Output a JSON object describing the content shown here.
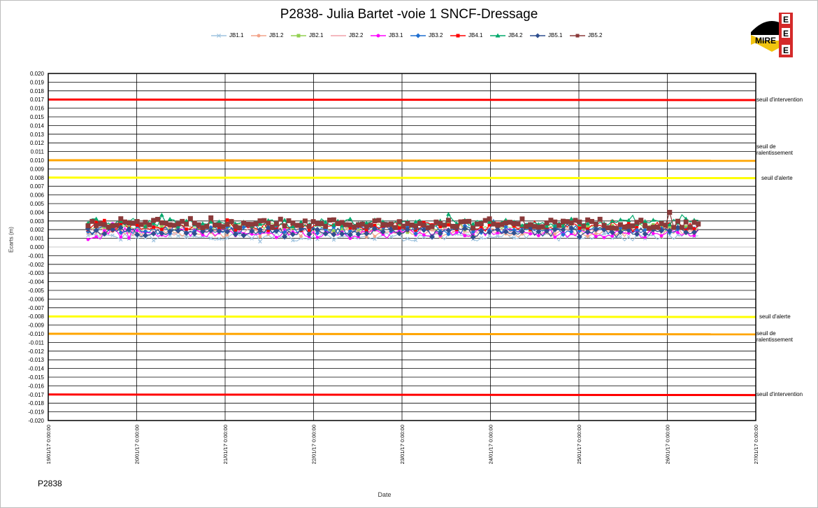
{
  "chart_title": "P2838- Julia Bartet -voie 1 SNCF-Dressage",
  "sensor_label": "P2838",
  "logo": {
    "letters": [
      "E",
      "E",
      "E"
    ],
    "text": "MIRE",
    "colors": {
      "red": "#d42a2a",
      "yellow": "#f1c40f",
      "black": "#000000"
    }
  },
  "thresholds": {
    "intervention_upper": "seuil d'intervention",
    "ralentissement_upper": "seuil de\nralentissement",
    "alerte_upper": "seuil d'alerte",
    "alerte_lower": "seuil d'alerte",
    "ralentissement_lower": "seuil de\nralentissement",
    "intervention_lower": "seuil d'intervention"
  },
  "chart_data": {
    "type": "line",
    "title": "P2838- Julia Bartet -voie 1 SNCF-Dressage",
    "xlabel": "Date",
    "ylabel": "Ecarts (m)",
    "ylim": [
      -0.02,
      0.02
    ],
    "y_tick_step": 0.001,
    "xlim": [
      "19/01/17 0:00:00",
      "27/01/17 0:00:00"
    ],
    "x_tick_labels": [
      "19/01/17 0:00:00",
      "20/01/17 0:00:00",
      "21/01/17 0:00:00",
      "22/01/17 0:00:00",
      "23/01/17 0:00:00",
      "24/01/17 0:00:00",
      "25/01/17 0:00:00",
      "26/01/17 0:00:00",
      "27/01/17 0:00:00"
    ],
    "grid": true,
    "legend": "top",
    "x_range_data": [
      0.45,
      7.35
    ],
    "threshold_lines": [
      {
        "y": 0.017,
        "color": "#ff0000"
      },
      {
        "y": 0.01,
        "color": "#ffa500"
      },
      {
        "y": 0.008,
        "color": "#ffff00"
      },
      {
        "y": -0.008,
        "color": "#ffff00"
      },
      {
        "y": -0.01,
        "color": "#ffa500"
      },
      {
        "y": -0.017,
        "color": "#ff0000"
      }
    ],
    "series": [
      {
        "name": "JB1.1",
        "color": "#9ec3df",
        "marker": "x",
        "mean": 0.0012
      },
      {
        "name": "JB1.2",
        "color": "#f2a48a",
        "marker": "circle",
        "mean": 0.0017
      },
      {
        "name": "JB2.1",
        "color": "#92d050",
        "marker": "square",
        "mean": 0.0023
      },
      {
        "name": "JB2.2",
        "color": "#f0a0a8",
        "marker": "none",
        "mean": 0.0019
      },
      {
        "name": "JB3.1",
        "color": "#ff00ff",
        "marker": "circle",
        "mean": 0.0016
      },
      {
        "name": "JB3.2",
        "color": "#1f6fd1",
        "marker": "diamond",
        "mean": 0.002
      },
      {
        "name": "JB4.1",
        "color": "#ff0000",
        "marker": "square",
        "mean": 0.0024
      },
      {
        "name": "JB4.2",
        "color": "#00a86b",
        "marker": "triangle",
        "mean": 0.0028
      },
      {
        "name": "JB5.1",
        "color": "#2f4f8f",
        "marker": "diamond",
        "mean": 0.0017
      },
      {
        "name": "JB5.2",
        "color": "#8b3a3a",
        "marker": "square",
        "mean": 0.0027
      }
    ]
  }
}
